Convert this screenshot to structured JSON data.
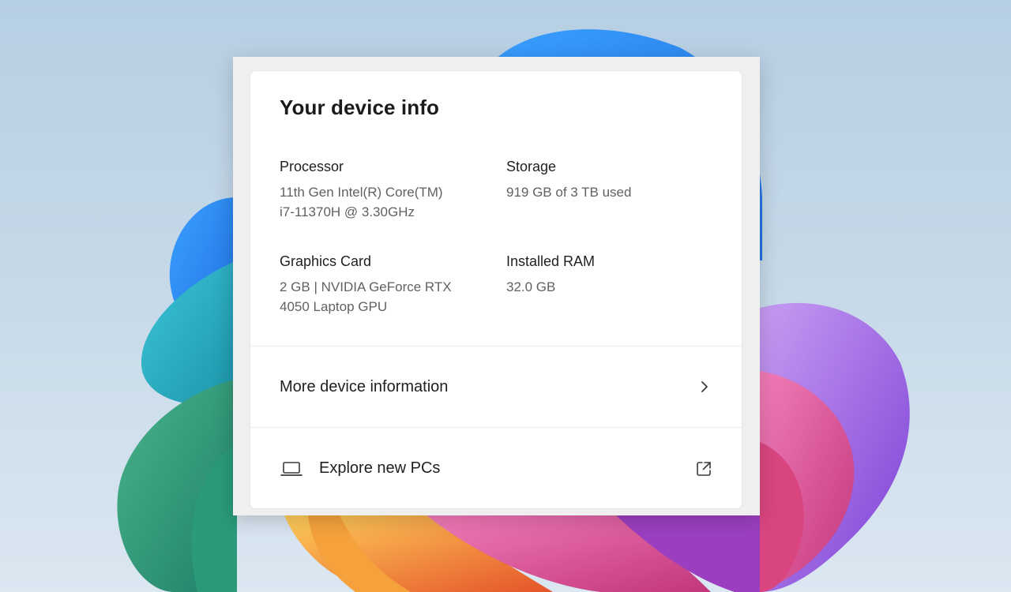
{
  "panel": {
    "title": "Your device info",
    "specs": {
      "processor": {
        "label": "Processor",
        "value_line1": "11th Gen Intel(R) Core(TM)",
        "value_line2": "i7-11370H @ 3.30GHz"
      },
      "storage": {
        "label": "Storage",
        "value_line1": "919 GB of 3 TB used"
      },
      "graphics": {
        "label": "Graphics Card",
        "value_line1": "2 GB | NVIDIA GeForce RTX",
        "value_line2": "4050 Laptop GPU"
      },
      "ram": {
        "label": "Installed RAM",
        "value_line1": "32.0 GB"
      }
    },
    "rows": {
      "more_info": {
        "label": "More device information",
        "icon": "chevron-right-icon"
      },
      "explore": {
        "label": "Explore new PCs",
        "leading_icon": "laptop-icon",
        "trailing_icon": "external-link-icon"
      }
    }
  },
  "colors": {
    "card_background": "#ffffff",
    "panel_background": "#efefef",
    "title_text": "#1b1b1b",
    "secondary_text": "#616161",
    "divider": "#ececec"
  }
}
